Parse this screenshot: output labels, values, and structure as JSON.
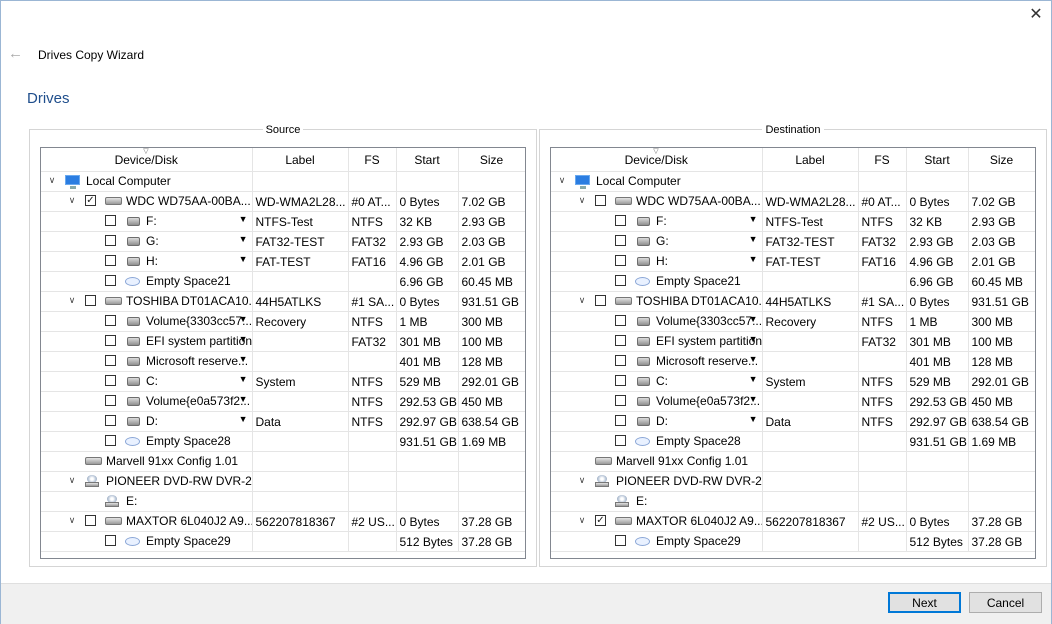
{
  "window": {
    "title": "Drives Copy Wizard",
    "close_label": "✕",
    "back_label": "←"
  },
  "page": {
    "heading": "Drives"
  },
  "columns": {
    "device": "Device/Disk",
    "label": "Label",
    "fs": "FS",
    "start": "Start",
    "size": "Size"
  },
  "panels": [
    {
      "legend": "Source",
      "rows": [
        {
          "level": 0,
          "type": "computer",
          "expand": "v",
          "check": null,
          "name": "Local Computer",
          "label": "",
          "fs": "",
          "start": "",
          "size": "",
          "dd": false
        },
        {
          "level": 1,
          "type": "hdd",
          "expand": "v",
          "check": true,
          "name": "WDC WD75AA-00BA...",
          "label": "WD-WMA2L28...",
          "fs": "#0 AT...",
          "start": "0 Bytes",
          "size": "7.02 GB",
          "dd": false
        },
        {
          "level": 2,
          "type": "part",
          "expand": "",
          "check": false,
          "name": "F:",
          "label": "NTFS-Test",
          "fs": "NTFS",
          "start": "32 KB",
          "size": "2.93 GB",
          "dd": true
        },
        {
          "level": 2,
          "type": "part",
          "expand": "",
          "check": false,
          "name": "G:",
          "label": "FAT32-TEST",
          "fs": "FAT32",
          "start": "2.93 GB",
          "size": "2.03 GB",
          "dd": true
        },
        {
          "level": 2,
          "type": "part",
          "expand": "",
          "check": false,
          "name": "H:",
          "label": "FAT-TEST",
          "fs": "FAT16",
          "start": "4.96 GB",
          "size": "2.01 GB",
          "dd": true
        },
        {
          "level": 2,
          "type": "empty",
          "expand": "",
          "check": false,
          "name": "Empty Space21",
          "label": "",
          "fs": "",
          "start": "6.96 GB",
          "size": "60.45 MB",
          "dd": false
        },
        {
          "level": 1,
          "type": "hdd",
          "expand": "v",
          "check": false,
          "name": "TOSHIBA DT01ACA10...",
          "label": "44H5ATLKS",
          "fs": "#1 SA...",
          "start": "0 Bytes",
          "size": "931.51 GB",
          "dd": false
        },
        {
          "level": 2,
          "type": "part",
          "expand": "",
          "check": false,
          "name": "Volume{3303cc57...",
          "label": "Recovery",
          "fs": "NTFS",
          "start": "1 MB",
          "size": "300 MB",
          "dd": true
        },
        {
          "level": 2,
          "type": "part",
          "expand": "",
          "check": false,
          "name": "EFI system partition",
          "label": "",
          "fs": "FAT32",
          "start": "301 MB",
          "size": "100 MB",
          "dd": true
        },
        {
          "level": 2,
          "type": "part",
          "expand": "",
          "check": false,
          "name": "Microsoft reserve...",
          "label": "",
          "fs": "",
          "start": "401 MB",
          "size": "128 MB",
          "dd": true
        },
        {
          "level": 2,
          "type": "part",
          "expand": "",
          "check": false,
          "name": "C:",
          "label": "System",
          "fs": "NTFS",
          "start": "529 MB",
          "size": "292.01 GB",
          "dd": true
        },
        {
          "level": 2,
          "type": "part",
          "expand": "",
          "check": false,
          "name": "Volume{e0a573f2...",
          "label": "",
          "fs": "NTFS",
          "start": "292.53 GB",
          "size": "450 MB",
          "dd": true
        },
        {
          "level": 2,
          "type": "part",
          "expand": "",
          "check": false,
          "name": "D:",
          "label": "Data",
          "fs": "NTFS",
          "start": "292.97 GB",
          "size": "638.54 GB",
          "dd": true
        },
        {
          "level": 2,
          "type": "empty",
          "expand": "",
          "check": false,
          "name": "Empty Space28",
          "label": "",
          "fs": "",
          "start": "931.51 GB",
          "size": "1.69 MB",
          "dd": false
        },
        {
          "level": 1,
          "type": "hdd",
          "expand": "",
          "check": null,
          "name": "Marvell 91xx Config 1.01",
          "label": "",
          "fs": "",
          "start": "",
          "size": "",
          "dd": false
        },
        {
          "level": 1,
          "type": "cdrom",
          "expand": "v",
          "check": null,
          "name": "PIONEER DVD-RW DVR-2...",
          "label": "",
          "fs": "",
          "start": "",
          "size": "",
          "dd": false
        },
        {
          "level": 2,
          "type": "cdrom",
          "expand": "",
          "check": null,
          "name": "E:",
          "label": "",
          "fs": "",
          "start": "",
          "size": "",
          "dd": false
        },
        {
          "level": 1,
          "type": "hdd",
          "expand": "v",
          "check": false,
          "name": "MAXTOR 6L040J2 A9...",
          "label": "562207818367",
          "fs": "#2 US...",
          "start": "0 Bytes",
          "size": "37.28 GB",
          "dd": false
        },
        {
          "level": 2,
          "type": "empty",
          "expand": "",
          "check": false,
          "name": "Empty Space29",
          "label": "",
          "fs": "",
          "start": "512 Bytes",
          "size": "37.28 GB",
          "dd": false
        }
      ]
    },
    {
      "legend": "Destination",
      "rows": [
        {
          "level": 0,
          "type": "computer",
          "expand": "v",
          "check": null,
          "name": "Local Computer",
          "label": "",
          "fs": "",
          "start": "",
          "size": "",
          "dd": false
        },
        {
          "level": 1,
          "type": "hdd",
          "expand": "v",
          "check": false,
          "name": "WDC WD75AA-00BA...",
          "label": "WD-WMA2L28...",
          "fs": "#0 AT...",
          "start": "0 Bytes",
          "size": "7.02 GB",
          "dd": false
        },
        {
          "level": 2,
          "type": "part",
          "expand": "",
          "check": false,
          "name": "F:",
          "label": "NTFS-Test",
          "fs": "NTFS",
          "start": "32 KB",
          "size": "2.93 GB",
          "dd": true
        },
        {
          "level": 2,
          "type": "part",
          "expand": "",
          "check": false,
          "name": "G:",
          "label": "FAT32-TEST",
          "fs": "FAT32",
          "start": "2.93 GB",
          "size": "2.03 GB",
          "dd": true
        },
        {
          "level": 2,
          "type": "part",
          "expand": "",
          "check": false,
          "name": "H:",
          "label": "FAT-TEST",
          "fs": "FAT16",
          "start": "4.96 GB",
          "size": "2.01 GB",
          "dd": true
        },
        {
          "level": 2,
          "type": "empty",
          "expand": "",
          "check": false,
          "name": "Empty Space21",
          "label": "",
          "fs": "",
          "start": "6.96 GB",
          "size": "60.45 MB",
          "dd": false
        },
        {
          "level": 1,
          "type": "hdd",
          "expand": "v",
          "check": false,
          "name": "TOSHIBA DT01ACA10...",
          "label": "44H5ATLKS",
          "fs": "#1 SA...",
          "start": "0 Bytes",
          "size": "931.51 GB",
          "dd": false
        },
        {
          "level": 2,
          "type": "part",
          "expand": "",
          "check": false,
          "name": "Volume{3303cc57...",
          "label": "Recovery",
          "fs": "NTFS",
          "start": "1 MB",
          "size": "300 MB",
          "dd": true
        },
        {
          "level": 2,
          "type": "part",
          "expand": "",
          "check": false,
          "name": "EFI system partition",
          "label": "",
          "fs": "FAT32",
          "start": "301 MB",
          "size": "100 MB",
          "dd": true
        },
        {
          "level": 2,
          "type": "part",
          "expand": "",
          "check": false,
          "name": "Microsoft reserve...",
          "label": "",
          "fs": "",
          "start": "401 MB",
          "size": "128 MB",
          "dd": true
        },
        {
          "level": 2,
          "type": "part",
          "expand": "",
          "check": false,
          "name": "C:",
          "label": "System",
          "fs": "NTFS",
          "start": "529 MB",
          "size": "292.01 GB",
          "dd": true
        },
        {
          "level": 2,
          "type": "part",
          "expand": "",
          "check": false,
          "name": "Volume{e0a573f2...",
          "label": "",
          "fs": "NTFS",
          "start": "292.53 GB",
          "size": "450 MB",
          "dd": true
        },
        {
          "level": 2,
          "type": "part",
          "expand": "",
          "check": false,
          "name": "D:",
          "label": "Data",
          "fs": "NTFS",
          "start": "292.97 GB",
          "size": "638.54 GB",
          "dd": true
        },
        {
          "level": 2,
          "type": "empty",
          "expand": "",
          "check": false,
          "name": "Empty Space28",
          "label": "",
          "fs": "",
          "start": "931.51 GB",
          "size": "1.69 MB",
          "dd": false
        },
        {
          "level": 1,
          "type": "hdd",
          "expand": "",
          "check": null,
          "name": "Marvell 91xx Config 1.01",
          "label": "",
          "fs": "",
          "start": "",
          "size": "",
          "dd": false
        },
        {
          "level": 1,
          "type": "cdrom",
          "expand": "v",
          "check": null,
          "name": "PIONEER DVD-RW DVR-2...",
          "label": "",
          "fs": "",
          "start": "",
          "size": "",
          "dd": false
        },
        {
          "level": 2,
          "type": "cdrom",
          "expand": "",
          "check": null,
          "name": "E:",
          "label": "",
          "fs": "",
          "start": "",
          "size": "",
          "dd": false
        },
        {
          "level": 1,
          "type": "hdd",
          "expand": "v",
          "check": true,
          "name": "MAXTOR 6L040J2 A9...",
          "label": "562207818367",
          "fs": "#2 US...",
          "start": "0 Bytes",
          "size": "37.28 GB",
          "dd": false
        },
        {
          "level": 2,
          "type": "empty",
          "expand": "",
          "check": false,
          "name": "Empty Space29",
          "label": "",
          "fs": "",
          "start": "512 Bytes",
          "size": "37.28 GB",
          "dd": false
        }
      ]
    }
  ],
  "buttons": {
    "next": "Next",
    "cancel": "Cancel"
  }
}
